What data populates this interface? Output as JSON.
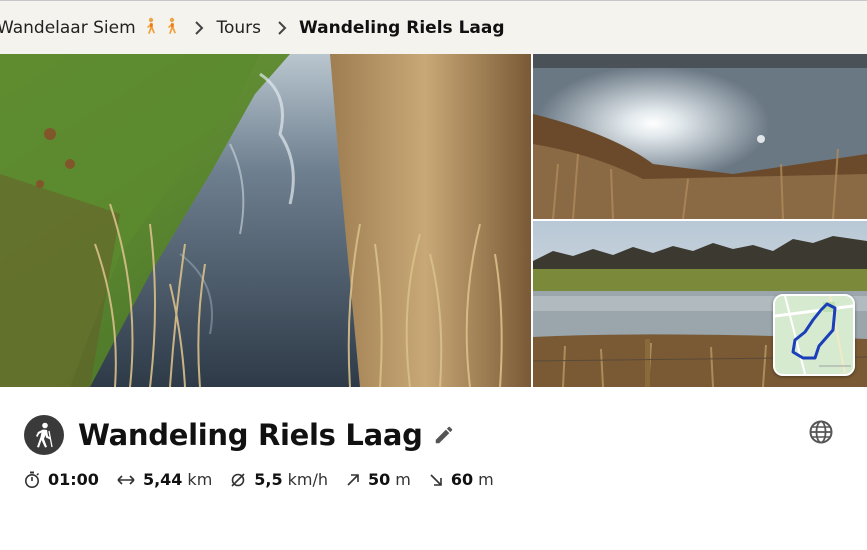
{
  "breadcrumb": {
    "home": "Wandelaar Siem",
    "section": "Tours",
    "current": "Wandeling Riels Laag"
  },
  "tour": {
    "title": "Wandeling Riels Laag"
  },
  "stats": {
    "duration": "01:00",
    "distance_value": "5,44",
    "distance_unit": "km",
    "speed_value": "5,5",
    "speed_unit": "km/h",
    "ascent_value": "50",
    "ascent_unit": "m",
    "descent_value": "60",
    "descent_unit": "m"
  },
  "icons": {
    "breadcrumb_sep": "chevron-right-icon",
    "hike": "hiking-icon",
    "edit": "pencil-icon",
    "globe": "globe-icon",
    "duration": "stopwatch-icon",
    "distance": "horizontal-arrows-icon",
    "speed": "average-icon",
    "ascent": "arrow-up-right-icon",
    "descent": "arrow-down-right-icon"
  },
  "colors": {
    "breadcrumb_bg": "#f5f3ee",
    "badge_bg": "#3a3a3a",
    "route_line": "#1a3fb8"
  }
}
